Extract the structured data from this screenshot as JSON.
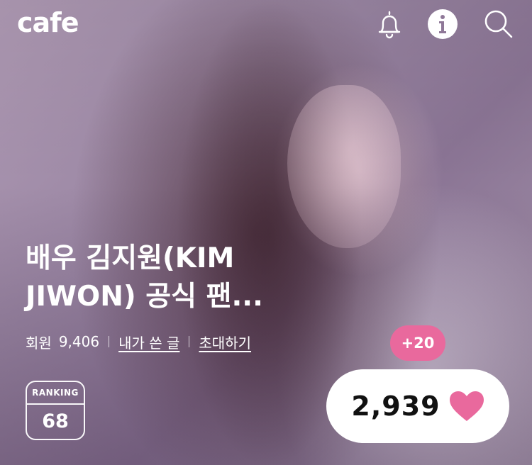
{
  "header": {
    "logo": "cafe",
    "icons": [
      "bell-icon",
      "info-icon",
      "search-icon"
    ]
  },
  "cafe": {
    "title_line1": "배우 김지원(KIM",
    "title_line2": "JIWON) 공식 팬...",
    "members_label": "회원",
    "members_count": "9,406",
    "my_posts_link": "내가 쓴 글",
    "invite_link": "초대하기"
  },
  "ranking": {
    "label": "RANKING",
    "value": "68"
  },
  "likes": {
    "increase": "+20",
    "count": "2,939",
    "heart_icon": "heart-icon"
  },
  "colors": {
    "accent_pink": "#e9699d",
    "white": "#ffffff"
  }
}
